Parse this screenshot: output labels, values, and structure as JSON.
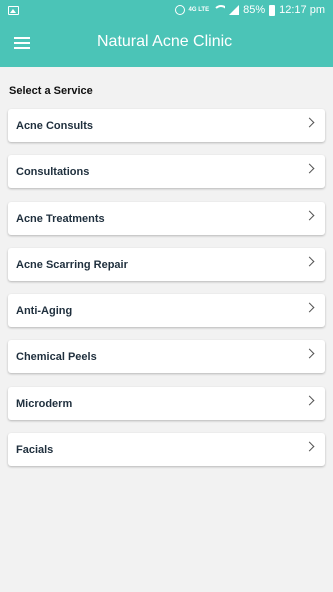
{
  "status_bar": {
    "battery": "85%",
    "time": "12:17 pm",
    "network": "4G LTE"
  },
  "app_bar": {
    "title": "Natural Acne Clinic"
  },
  "section_label": "Select a Service",
  "services": [
    {
      "label": "Acne Consults"
    },
    {
      "label": "Consultations"
    },
    {
      "label": "Acne Treatments"
    },
    {
      "label": "Acne Scarring Repair"
    },
    {
      "label": "Anti-Aging"
    },
    {
      "label": "Chemical Peels"
    },
    {
      "label": "Microderm"
    },
    {
      "label": "Facials"
    }
  ],
  "colors": {
    "primary": "#4bc4b7",
    "background": "#f2f2f2",
    "item_text": "#1f2f3d"
  }
}
